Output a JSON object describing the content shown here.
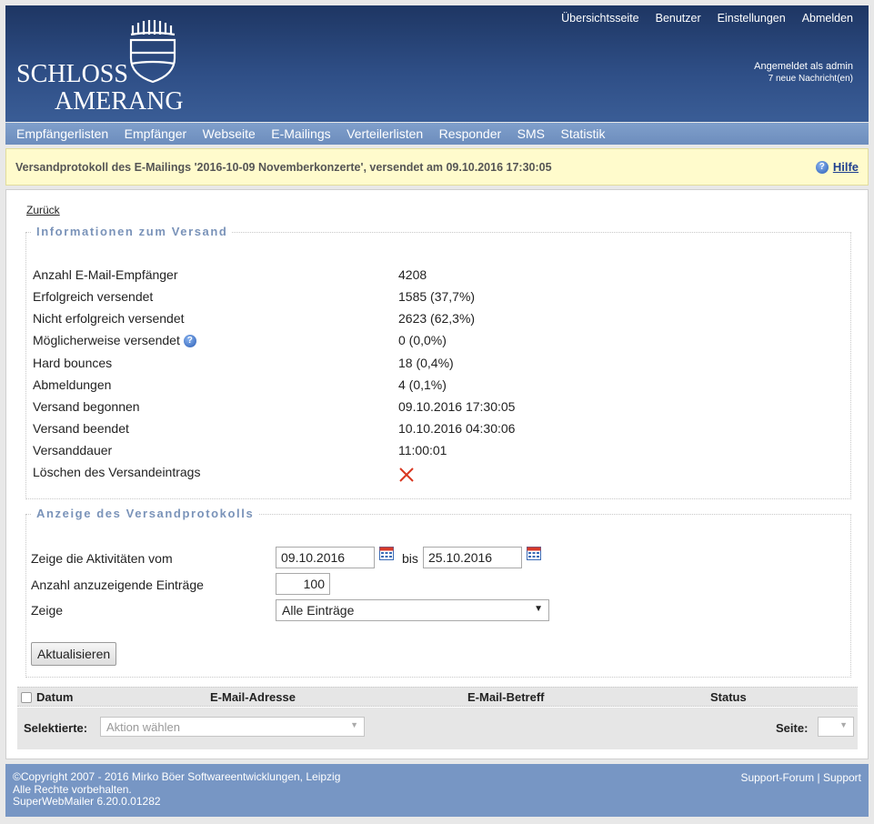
{
  "header": {
    "logo_line1": "SCHLOSS",
    "logo_line2": "AMERANG",
    "top_links": [
      "Übersichtsseite",
      "Benutzer",
      "Einstellungen",
      "Abmelden"
    ],
    "login_status": "Angemeldet als admin",
    "messages": "7 neue Nachricht(en)"
  },
  "nav": {
    "items": [
      "Empfängerlisten",
      "Empfänger",
      "Webseite",
      "E-Mailings",
      "Verteilerlisten",
      "Responder",
      "SMS",
      "Statistik"
    ]
  },
  "titlebar": {
    "title": "Versandprotokoll des E-Mailings '2016-10-09 Novemberkonzerte', versendet am 09.10.2016 17:30:05",
    "help_label": "Hilfe"
  },
  "main": {
    "back_link": "Zurück",
    "info": {
      "legend": "Informationen zum Versand",
      "rows": [
        {
          "label": "Anzahl E-Mail-Empfänger",
          "value": "4208"
        },
        {
          "label": "Erfolgreich versendet",
          "value": "1585 (37,7%)"
        },
        {
          "label": "Nicht erfolgreich versendet",
          "value": "2623 (62,3%)"
        },
        {
          "label": "Möglicherweise versendet",
          "value": "0 (0,0%)"
        },
        {
          "label": "Hard bounces",
          "value": "18 (0,4%)"
        },
        {
          "label": "Abmeldungen",
          "value": "4 (0,1%)"
        },
        {
          "label": "Versand begonnen",
          "value": "09.10.2016 17:30:05"
        },
        {
          "label": "Versand beendet",
          "value": "10.10.2016 04:30:06"
        },
        {
          "label": "Versanddauer",
          "value": "11:00:01"
        },
        {
          "label": "Löschen des Versandeintrags",
          "value": ""
        }
      ]
    },
    "protocol": {
      "legend": "Anzeige des Versandprotokolls",
      "from_label": "Zeige die Aktivitäten vom",
      "from_value": "09.10.2016",
      "bis_label": "bis",
      "to_value": "25.10.2016",
      "count_label": "Anzahl anzuzeigende Einträge",
      "count_value": "100",
      "show_label": "Zeige",
      "show_value": "Alle Einträge",
      "update_button": "Aktualisieren"
    },
    "table": {
      "columns": [
        "Datum",
        "E-Mail-Adresse",
        "E-Mail-Betreff",
        "Status"
      ],
      "selected_label": "Selektierte:",
      "action_placeholder": "Aktion wählen",
      "page_label": "Seite:"
    }
  },
  "footer": {
    "copyright": "©Copyright 2007 - 2016 Mirko Böer Softwareentwicklungen, Leipzig",
    "rights": "Alle Rechte vorbehalten.",
    "version": "SuperWebMailer 6.20.0.01282",
    "link_forum": "Support-Forum",
    "separator": "|",
    "link_support": "Support"
  },
  "colors": {
    "header_dark": "#1e3663",
    "nav": "#7796c4",
    "title_bg": "#fffbcc",
    "legend": "#7a93b9",
    "delete": "#d9361f"
  }
}
